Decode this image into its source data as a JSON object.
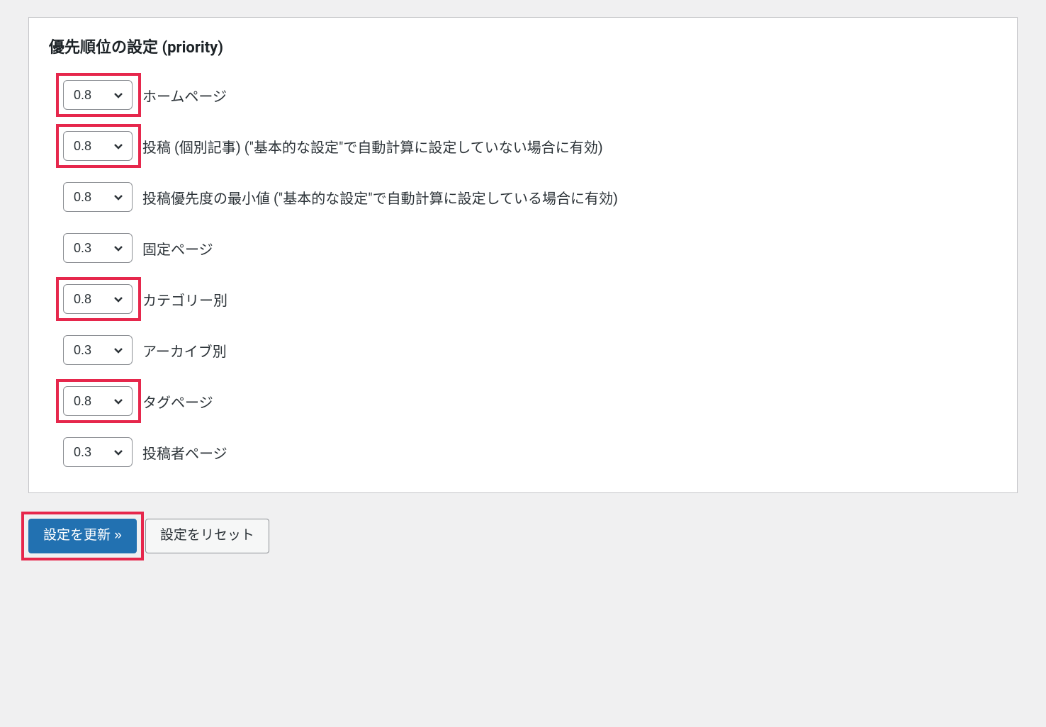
{
  "panel": {
    "title": "優先順位の設定 (priority)",
    "rows": [
      {
        "value": "0.8",
        "label": "ホームページ",
        "highlighted": true
      },
      {
        "value": "0.8",
        "label": "投稿 (個別記事) (\"基本的な設定\"で自動計算に設定していない場合に有効)",
        "highlighted": true
      },
      {
        "value": "0.8",
        "label": "投稿優先度の最小値 (\"基本的な設定\"で自動計算に設定している場合に有効)",
        "highlighted": false
      },
      {
        "value": "0.3",
        "label": "固定ページ",
        "highlighted": false
      },
      {
        "value": "0.8",
        "label": "カテゴリー別",
        "highlighted": true
      },
      {
        "value": "0.3",
        "label": "アーカイブ別",
        "highlighted": false
      },
      {
        "value": "0.8",
        "label": "タグページ",
        "highlighted": true
      },
      {
        "value": "0.3",
        "label": "投稿者ページ",
        "highlighted": false
      }
    ]
  },
  "buttons": {
    "update": "設定を更新 »",
    "reset": "設定をリセット"
  }
}
